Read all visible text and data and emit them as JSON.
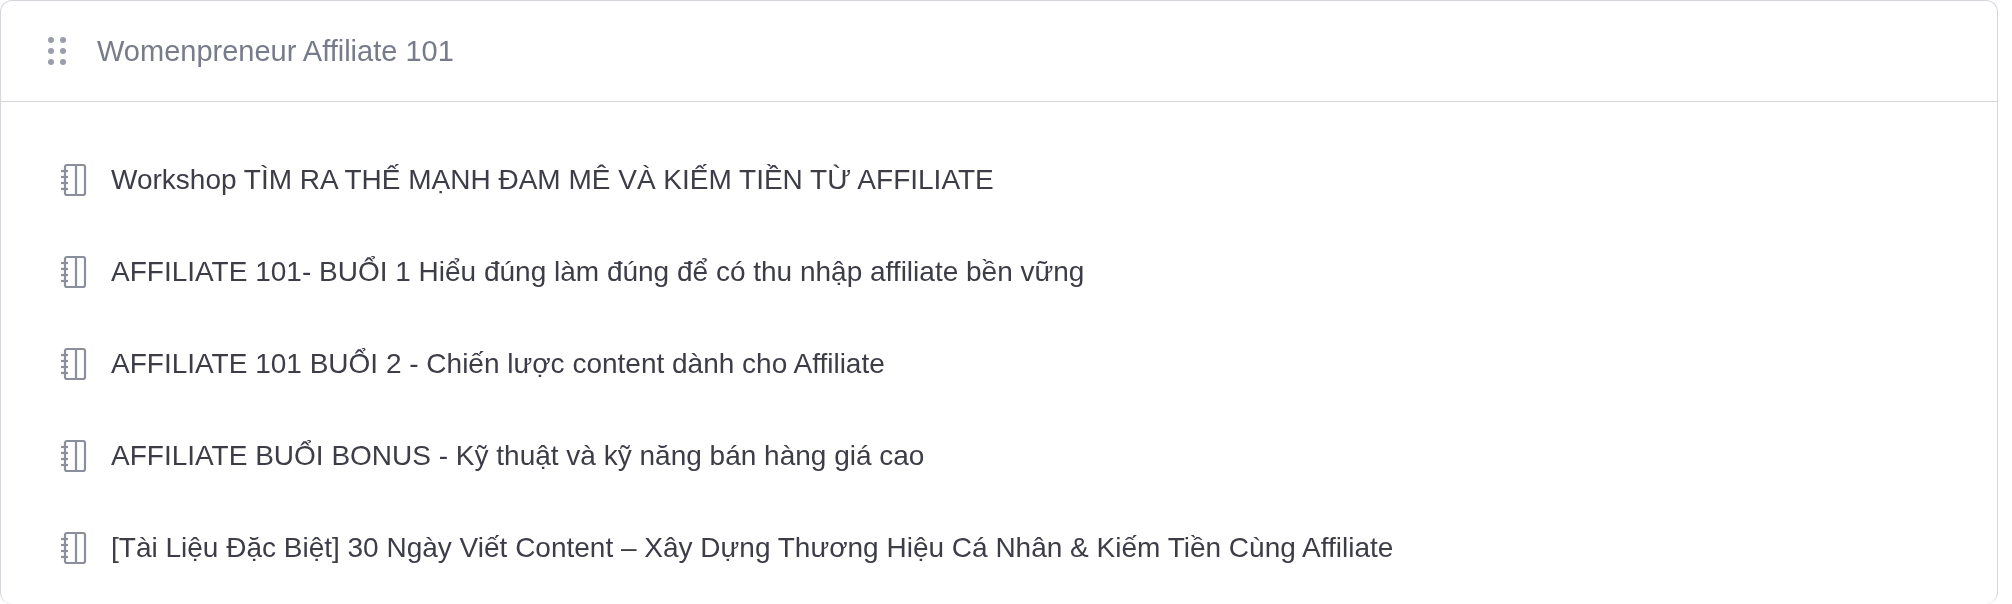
{
  "section": {
    "title": "Womenpreneur Affiliate 101"
  },
  "lessons": [
    {
      "title": "Workshop TÌM RA THẾ MẠNH ĐAM MÊ VÀ KIẾM TIỀN TỪ AFFILIATE"
    },
    {
      "title": "AFFILIATE 101- BUỔI 1 Hiểu đúng làm đúng để có thu nhập affiliate bền vững"
    },
    {
      "title": "AFFILIATE 101 BUỔI 2 - Chiến lược content dành cho Affiliate"
    },
    {
      "title": "AFFILIATE BUỔI BONUS - Kỹ thuật và kỹ năng bán hàng giá cao"
    },
    {
      "title": "[Tài Liệu Đặc Biệt] 30 Ngày Viết Content – Xây Dựng Thương Hiệu Cá Nhân & Kiếm Tiền Cùng Affiliate"
    }
  ]
}
